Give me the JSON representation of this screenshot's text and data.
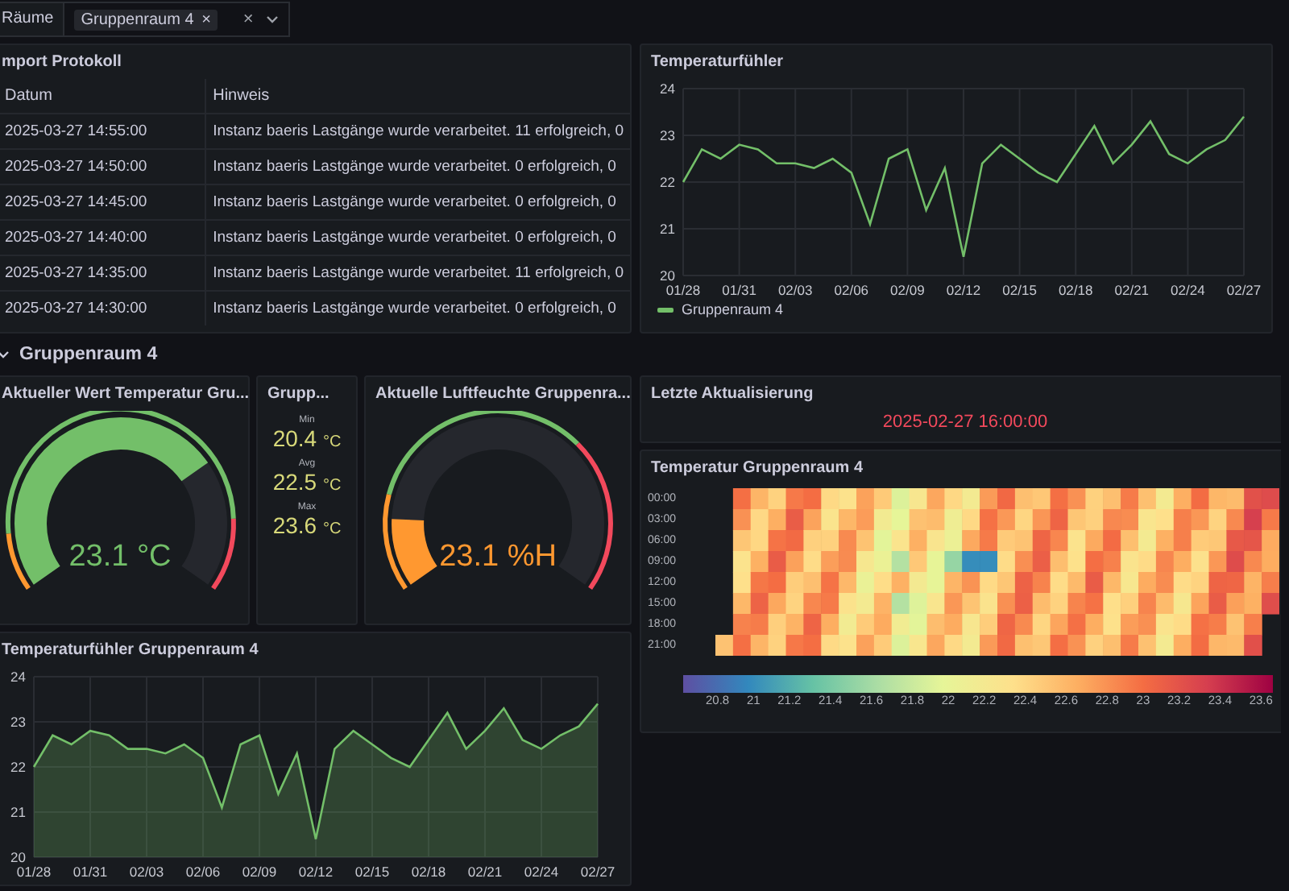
{
  "variables": {
    "label": "Räume",
    "chips": [
      {
        "text": "Gruppenraum 4",
        "remove": "×"
      }
    ],
    "clear": "×"
  },
  "import_panel": {
    "title": "mport Protokoll",
    "columns": [
      "Datum",
      "Hinweis"
    ],
    "rows": [
      [
        "2025-03-27 14:55:00",
        "Instanz baeris Lastgänge wurde verarbeitet. 11 erfolgreich, 0"
      ],
      [
        "2025-03-27 14:50:00",
        "Instanz baeris Lastgänge wurde verarbeitet. 0 erfolgreich, 0"
      ],
      [
        "2025-03-27 14:45:00",
        "Instanz baeris Lastgänge wurde verarbeitet. 0 erfolgreich, 0"
      ],
      [
        "2025-03-27 14:40:00",
        "Instanz baeris Lastgänge wurde verarbeitet. 0 erfolgreich, 0"
      ],
      [
        "2025-03-27 14:35:00",
        "Instanz baeris Lastgänge wurde verarbeitet. 11 erfolgreich, 0"
      ],
      [
        "2025-03-27 14:30:00",
        "Instanz baeris Lastgänge wurde verarbeitet. 0 erfolgreich, 0"
      ]
    ]
  },
  "temp_chart_panel": {
    "title": "Temperaturfühler",
    "chart_data": {
      "type": "line",
      "grid": true,
      "categories": [
        "01/28",
        null,
        null,
        "01/31",
        null,
        null,
        "02/03",
        null,
        null,
        "02/06",
        null,
        null,
        "02/09",
        null,
        null,
        "02/12",
        null,
        null,
        "02/15",
        null,
        null,
        "02/18",
        null,
        null,
        "02/21",
        null,
        null,
        "02/24",
        null,
        null,
        "02/27"
      ],
      "ylim": [
        20,
        24
      ],
      "yticks": [
        20,
        21,
        22,
        23,
        24
      ],
      "series": [
        {
          "name": "Gruppenraum 4",
          "color": "#73bf69",
          "values": [
            22.0,
            22.7,
            22.5,
            22.8,
            22.7,
            22.4,
            22.4,
            22.3,
            22.5,
            22.2,
            21.1,
            22.5,
            22.7,
            21.4,
            22.3,
            20.4,
            22.4,
            22.8,
            22.5,
            22.2,
            22.0,
            22.6,
            23.2,
            22.4,
            22.8,
            23.3,
            22.6,
            22.4,
            22.7,
            22.9,
            23.4
          ]
        }
      ]
    }
  },
  "row": {
    "title": "Gruppenraum 4",
    "expanded": true
  },
  "gauges": [
    {
      "title": "Aktueller Wert Temperatur Gru...",
      "value": "23.1 °C",
      "color": "#73bf69"
    },
    {
      "title": "Aktuelle Luftfeuchte Gruppenra...",
      "value": "23.1 %H",
      "color": "#ff9830"
    }
  ],
  "stats": {
    "title": "Grupp...",
    "items": [
      {
        "label": "Min",
        "value": "20.4",
        "unit": "°C"
      },
      {
        "label": "Avg",
        "value": "22.5",
        "unit": "°C"
      },
      {
        "label": "Max",
        "value": "23.6",
        "unit": "°C"
      }
    ]
  },
  "last_update": {
    "title": "Letzte Aktualisierung",
    "value": "2025-02-27 16:00:00"
  },
  "heatmap": {
    "title": "Temperatur Gruppenraum 4",
    "y_labels": [
      "00:00",
      "03:00",
      "06:00",
      "09:00",
      "12:00",
      "15:00",
      "18:00",
      "21:00"
    ],
    "scale_labels": [
      "20.8",
      "21",
      "21.2",
      "21.4",
      "21.6",
      "21.8",
      "22",
      "22.2",
      "22.4",
      "22.6",
      "22.8",
      "23",
      "23.2",
      "23.4",
      "23.6"
    ]
  },
  "area_chart_panel": {
    "title": "Temperaturfühler Gruppenraum 4",
    "chart_data": {
      "type": "area",
      "grid": true,
      "categories": [
        "01/28",
        null,
        null,
        "01/31",
        null,
        null,
        "02/03",
        null,
        null,
        "02/06",
        null,
        null,
        "02/09",
        null,
        null,
        "02/12",
        null,
        null,
        "02/15",
        null,
        null,
        "02/18",
        null,
        null,
        "02/21",
        null,
        null,
        "02/24",
        null,
        null,
        "02/27"
      ],
      "ylim": [
        20,
        24
      ],
      "yticks": [
        20,
        21,
        22,
        23,
        24
      ],
      "series": [
        {
          "color": "#73bf69",
          "values": [
            22.0,
            22.7,
            22.5,
            22.8,
            22.7,
            22.4,
            22.4,
            22.3,
            22.5,
            22.2,
            21.1,
            22.5,
            22.7,
            21.4,
            22.3,
            20.4,
            22.4,
            22.8,
            22.5,
            22.2,
            22.0,
            22.6,
            23.2,
            22.4,
            22.8,
            23.3,
            22.6,
            22.4,
            22.7,
            22.9,
            23.4
          ]
        }
      ]
    }
  }
}
